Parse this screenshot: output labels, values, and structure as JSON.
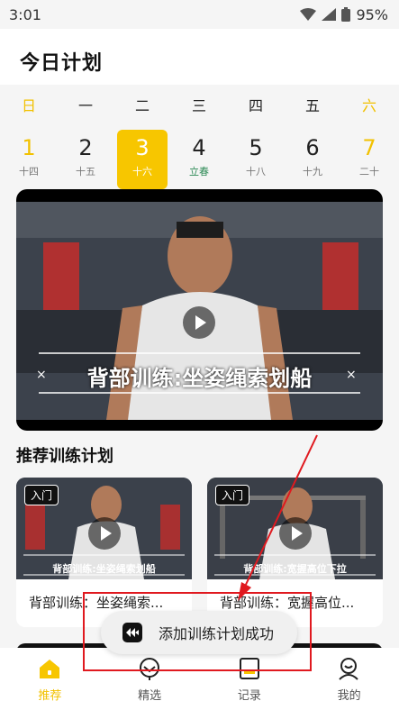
{
  "status_bar": {
    "time": "3:01",
    "battery": "95%"
  },
  "header": {
    "title": "今日计划"
  },
  "week": {
    "days": [
      {
        "weekday": "日",
        "date": "1",
        "lunar": "十四",
        "weekend": true,
        "selected": false,
        "solar_term": false
      },
      {
        "weekday": "一",
        "date": "2",
        "lunar": "十五",
        "weekend": false,
        "selected": false,
        "solar_term": false
      },
      {
        "weekday": "二",
        "date": "3",
        "lunar": "十六",
        "weekend": false,
        "selected": true,
        "solar_term": false
      },
      {
        "weekday": "三",
        "date": "4",
        "lunar": "立春",
        "weekend": false,
        "selected": false,
        "solar_term": true
      },
      {
        "weekday": "四",
        "date": "5",
        "lunar": "十八",
        "weekend": false,
        "selected": false,
        "solar_term": false
      },
      {
        "weekday": "五",
        "date": "6",
        "lunar": "十九",
        "weekend": false,
        "selected": false,
        "solar_term": false
      },
      {
        "weekday": "六",
        "date": "7",
        "lunar": "二十",
        "weekend": true,
        "selected": false,
        "solar_term": false
      }
    ]
  },
  "feature": {
    "caption": "背部训练:坐姿绳索划船",
    "icon": "play-icon"
  },
  "recommend": {
    "title": "推荐训练计划",
    "cards": [
      {
        "badge": "入门",
        "thumb_caption": "背部训练:坐姿绳索划船",
        "title": "背部训练：坐姿绳索..."
      },
      {
        "badge": "入门",
        "thumb_caption": "背部训练:宽握高位下拉",
        "title": "背部训练：宽握高位..."
      }
    ]
  },
  "toast": {
    "text": "添加训练计划成功"
  },
  "bottom_nav": {
    "items": [
      {
        "label": "推荐",
        "icon": "home-icon",
        "active": true
      },
      {
        "label": "精选",
        "icon": "selected-icon",
        "active": false
      },
      {
        "label": "记录",
        "icon": "record-icon",
        "active": false
      },
      {
        "label": "我的",
        "icon": "profile-icon",
        "active": false
      }
    ]
  },
  "colors": {
    "accent": "#f7c600",
    "annotation": "#e0191f"
  }
}
